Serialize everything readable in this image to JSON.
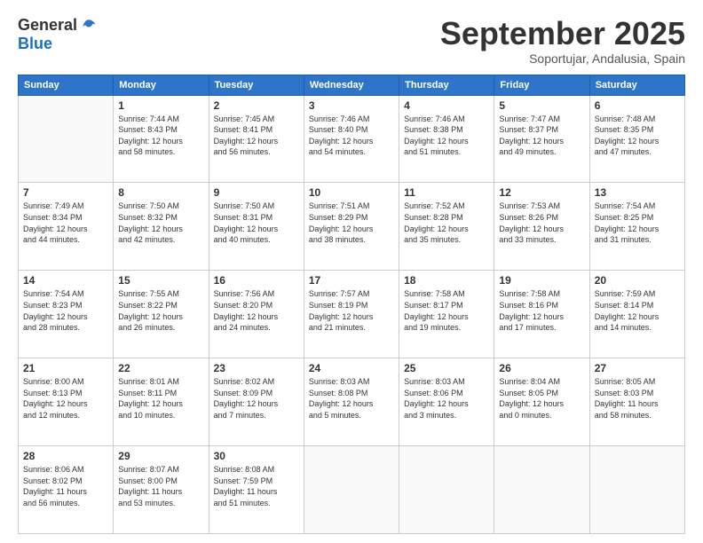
{
  "logo": {
    "general": "General",
    "blue": "Blue"
  },
  "header": {
    "month": "September 2025",
    "location": "Soportujar, Andalusia, Spain"
  },
  "days": [
    "Sunday",
    "Monday",
    "Tuesday",
    "Wednesday",
    "Thursday",
    "Friday",
    "Saturday"
  ],
  "weeks": [
    [
      {
        "day": "",
        "content": ""
      },
      {
        "day": "1",
        "content": "Sunrise: 7:44 AM\nSunset: 8:43 PM\nDaylight: 12 hours\nand 58 minutes."
      },
      {
        "day": "2",
        "content": "Sunrise: 7:45 AM\nSunset: 8:41 PM\nDaylight: 12 hours\nand 56 minutes."
      },
      {
        "day": "3",
        "content": "Sunrise: 7:46 AM\nSunset: 8:40 PM\nDaylight: 12 hours\nand 54 minutes."
      },
      {
        "day": "4",
        "content": "Sunrise: 7:46 AM\nSunset: 8:38 PM\nDaylight: 12 hours\nand 51 minutes."
      },
      {
        "day": "5",
        "content": "Sunrise: 7:47 AM\nSunset: 8:37 PM\nDaylight: 12 hours\nand 49 minutes."
      },
      {
        "day": "6",
        "content": "Sunrise: 7:48 AM\nSunset: 8:35 PM\nDaylight: 12 hours\nand 47 minutes."
      }
    ],
    [
      {
        "day": "7",
        "content": "Sunrise: 7:49 AM\nSunset: 8:34 PM\nDaylight: 12 hours\nand 44 minutes."
      },
      {
        "day": "8",
        "content": "Sunrise: 7:50 AM\nSunset: 8:32 PM\nDaylight: 12 hours\nand 42 minutes."
      },
      {
        "day": "9",
        "content": "Sunrise: 7:50 AM\nSunset: 8:31 PM\nDaylight: 12 hours\nand 40 minutes."
      },
      {
        "day": "10",
        "content": "Sunrise: 7:51 AM\nSunset: 8:29 PM\nDaylight: 12 hours\nand 38 minutes."
      },
      {
        "day": "11",
        "content": "Sunrise: 7:52 AM\nSunset: 8:28 PM\nDaylight: 12 hours\nand 35 minutes."
      },
      {
        "day": "12",
        "content": "Sunrise: 7:53 AM\nSunset: 8:26 PM\nDaylight: 12 hours\nand 33 minutes."
      },
      {
        "day": "13",
        "content": "Sunrise: 7:54 AM\nSunset: 8:25 PM\nDaylight: 12 hours\nand 31 minutes."
      }
    ],
    [
      {
        "day": "14",
        "content": "Sunrise: 7:54 AM\nSunset: 8:23 PM\nDaylight: 12 hours\nand 28 minutes."
      },
      {
        "day": "15",
        "content": "Sunrise: 7:55 AM\nSunset: 8:22 PM\nDaylight: 12 hours\nand 26 minutes."
      },
      {
        "day": "16",
        "content": "Sunrise: 7:56 AM\nSunset: 8:20 PM\nDaylight: 12 hours\nand 24 minutes."
      },
      {
        "day": "17",
        "content": "Sunrise: 7:57 AM\nSunset: 8:19 PM\nDaylight: 12 hours\nand 21 minutes."
      },
      {
        "day": "18",
        "content": "Sunrise: 7:58 AM\nSunset: 8:17 PM\nDaylight: 12 hours\nand 19 minutes."
      },
      {
        "day": "19",
        "content": "Sunrise: 7:58 AM\nSunset: 8:16 PM\nDaylight: 12 hours\nand 17 minutes."
      },
      {
        "day": "20",
        "content": "Sunrise: 7:59 AM\nSunset: 8:14 PM\nDaylight: 12 hours\nand 14 minutes."
      }
    ],
    [
      {
        "day": "21",
        "content": "Sunrise: 8:00 AM\nSunset: 8:13 PM\nDaylight: 12 hours\nand 12 minutes."
      },
      {
        "day": "22",
        "content": "Sunrise: 8:01 AM\nSunset: 8:11 PM\nDaylight: 12 hours\nand 10 minutes."
      },
      {
        "day": "23",
        "content": "Sunrise: 8:02 AM\nSunset: 8:09 PM\nDaylight: 12 hours\nand 7 minutes."
      },
      {
        "day": "24",
        "content": "Sunrise: 8:03 AM\nSunset: 8:08 PM\nDaylight: 12 hours\nand 5 minutes."
      },
      {
        "day": "25",
        "content": "Sunrise: 8:03 AM\nSunset: 8:06 PM\nDaylight: 12 hours\nand 3 minutes."
      },
      {
        "day": "26",
        "content": "Sunrise: 8:04 AM\nSunset: 8:05 PM\nDaylight: 12 hours\nand 0 minutes."
      },
      {
        "day": "27",
        "content": "Sunrise: 8:05 AM\nSunset: 8:03 PM\nDaylight: 11 hours\nand 58 minutes."
      }
    ],
    [
      {
        "day": "28",
        "content": "Sunrise: 8:06 AM\nSunset: 8:02 PM\nDaylight: 11 hours\nand 56 minutes."
      },
      {
        "day": "29",
        "content": "Sunrise: 8:07 AM\nSunset: 8:00 PM\nDaylight: 11 hours\nand 53 minutes."
      },
      {
        "day": "30",
        "content": "Sunrise: 8:08 AM\nSunset: 7:59 PM\nDaylight: 11 hours\nand 51 minutes."
      },
      {
        "day": "",
        "content": ""
      },
      {
        "day": "",
        "content": ""
      },
      {
        "day": "",
        "content": ""
      },
      {
        "day": "",
        "content": ""
      }
    ]
  ]
}
